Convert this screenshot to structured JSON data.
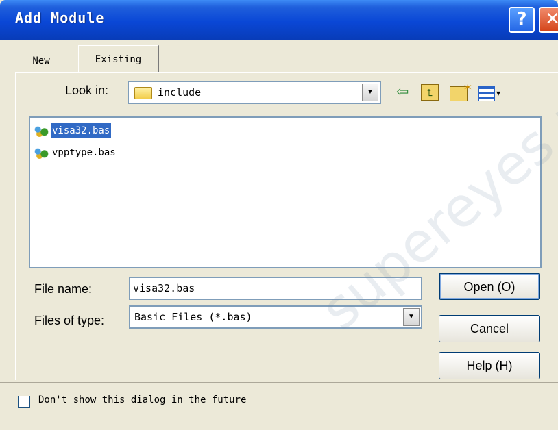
{
  "window": {
    "title": "Add Module",
    "help_glyph": "?",
    "close_glyph": "✕"
  },
  "tabs": [
    {
      "label": "New",
      "active": false
    },
    {
      "label": "Existing",
      "active": true
    }
  ],
  "look_in": {
    "label": "Look in:",
    "value": "include",
    "folder_icon": "folder-icon"
  },
  "toolbar": {
    "back_icon": "back-arrow-icon",
    "up_icon": "up-folder-icon",
    "new_folder_icon": "new-folder-icon",
    "view_menu_icon": "view-menu-icon",
    "back_glyph": "⇦",
    "up_glyph": "⮤",
    "view_caret": "▾"
  },
  "file_list": {
    "items": [
      {
        "name": "visa32.bas",
        "selected": true,
        "icon": "vb-module-icon"
      },
      {
        "name": "vpptype.bas",
        "selected": false,
        "icon": "vb-module-icon"
      }
    ]
  },
  "file_name": {
    "label": "File name:",
    "value": "visa32.bas"
  },
  "files_of_type": {
    "label": "Files of type:",
    "value": "Basic Files (*.bas)"
  },
  "buttons": {
    "open": "Open (O)",
    "cancel": "Cancel",
    "help": "Help (H)"
  },
  "dont_show": {
    "label": "Don't show this dialog in the future",
    "checked": false
  },
  "watermark": "supereyes.ru",
  "colors": {
    "titlebar": "#0a47d6",
    "selection": "#316ac5",
    "dialog_bg": "#ece9d8"
  }
}
